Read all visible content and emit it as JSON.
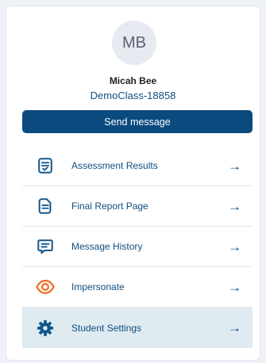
{
  "profile": {
    "initials": "MB",
    "name": "Micah Bee",
    "class_name": "DemoClass-18858"
  },
  "actions": {
    "send_message_label": "Send message"
  },
  "menu": {
    "items": [
      {
        "label": "Assessment Results",
        "icon": "assessment-results-icon",
        "arrow": "→"
      },
      {
        "label": "Final Report Page",
        "icon": "report-document-icon",
        "arrow": "→"
      },
      {
        "label": "Message History",
        "icon": "message-icon",
        "arrow": "→"
      },
      {
        "label": "Impersonate",
        "icon": "eye-icon",
        "arrow": "→"
      },
      {
        "label": "Student Settings",
        "icon": "gear-icon",
        "arrow": "→",
        "selected": true
      }
    ]
  },
  "colors": {
    "primary": "#0b4a7e",
    "link_text": "#0f4e80",
    "icon_blue": "#12578c",
    "icon_orange": "#f26a21",
    "selected_row": "#dfeaf1"
  }
}
